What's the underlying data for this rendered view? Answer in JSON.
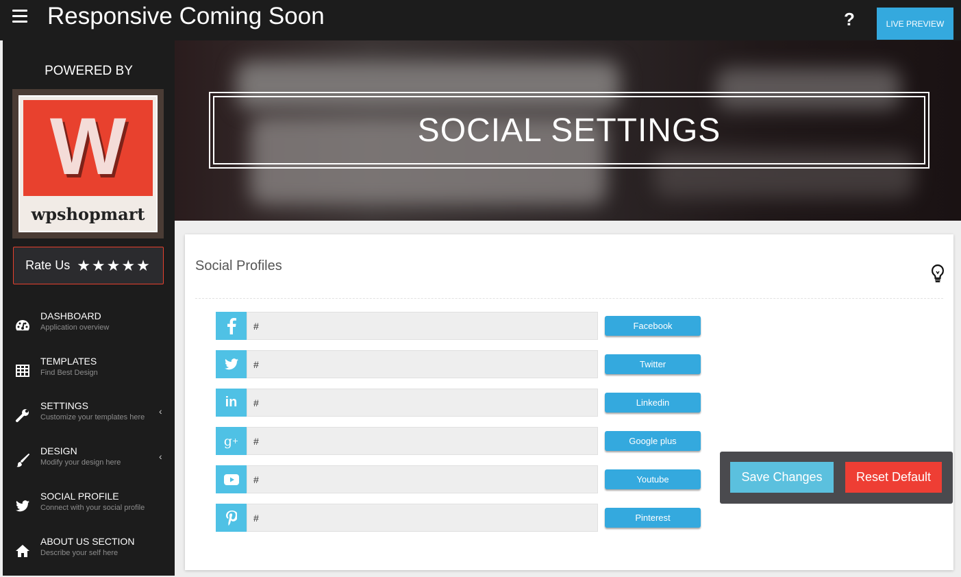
{
  "header": {
    "title": "Responsive Coming Soon",
    "help_label": "?",
    "live_preview_label": "LIVE PREVIEW"
  },
  "sidebar": {
    "powered_by": "POWERED BY",
    "logo_letter": "W",
    "logo_text": "wpshopmart",
    "rate_label": "Rate Us",
    "stars": "★★★★★",
    "rating": 5,
    "items": [
      {
        "title": "DASHBOARD",
        "subtitle": "Application overview",
        "icon": "dashboard-icon"
      },
      {
        "title": "TEMPLATES",
        "subtitle": "Find Best Design",
        "icon": "templates-icon"
      },
      {
        "title": "SETTINGS",
        "subtitle": "Customize your templates here",
        "icon": "wrench-icon",
        "chevron": "‹"
      },
      {
        "title": "DESIGN",
        "subtitle": "Modify your design here",
        "icon": "brush-icon",
        "chevron": "‹"
      },
      {
        "title": "SOCIAL PROFILE",
        "subtitle": "Connect with your social profile",
        "icon": "twitter-icon"
      },
      {
        "title": "ABOUT US SECTION",
        "subtitle": "Describe your self here",
        "icon": "home-icon"
      }
    ]
  },
  "hero": {
    "title": "SOCIAL SETTINGS"
  },
  "panel": {
    "title": "Social Profiles",
    "profiles": [
      {
        "icon": "facebook-icon",
        "glyph": "f",
        "value": "#",
        "button": "Facebook"
      },
      {
        "icon": "twitter-icon",
        "glyph": "t",
        "value": "#",
        "button": "Twitter"
      },
      {
        "icon": "linkedin-icon",
        "glyph": "in",
        "value": "#",
        "button": "Linkedin"
      },
      {
        "icon": "google-plus-icon",
        "glyph": "g+",
        "value": "#",
        "button": "Google plus"
      },
      {
        "icon": "youtube-icon",
        "glyph": "▶",
        "value": "#",
        "button": "Youtube"
      },
      {
        "icon": "pinterest-icon",
        "glyph": "p",
        "value": "#",
        "button": "Pinterest"
      }
    ]
  },
  "actions": {
    "save": "Save Changes",
    "reset": "Reset Default"
  },
  "colors": {
    "accent": "#34a9de",
    "social_icon_bg": "#4fc1e5",
    "reset": "#ee3e34",
    "save": "#5bc0de",
    "dark": "#1c1c1c"
  }
}
